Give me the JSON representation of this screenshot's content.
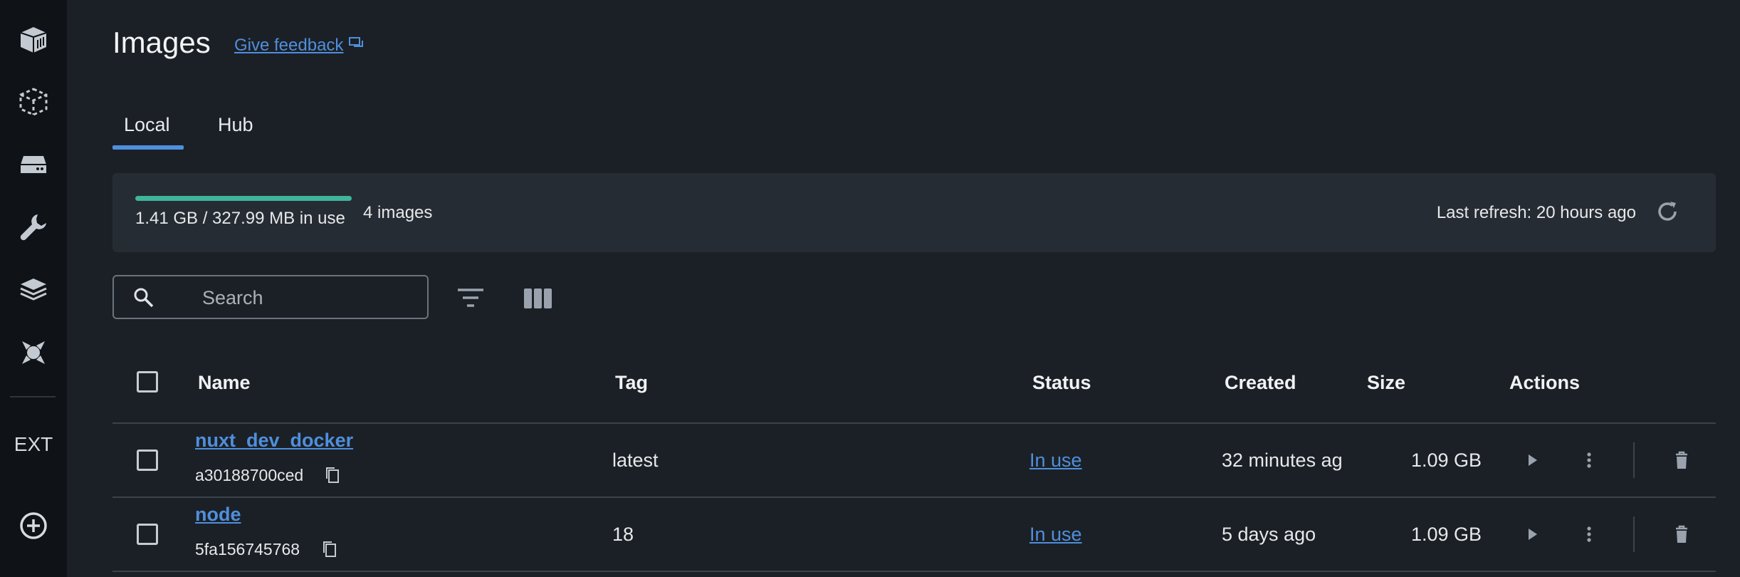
{
  "page": {
    "title": "Images",
    "feedback_label": "Give feedback"
  },
  "sidebar": {
    "icons": [
      "containers-icon",
      "dev-environments-icon",
      "volumes-icon",
      "build-tools-icon",
      "images-layers-icon",
      "extensions-icon"
    ],
    "ext_label": "EXT",
    "add_icon": "add-circle-icon"
  },
  "tabs": [
    {
      "label": "Local",
      "active": true
    },
    {
      "label": "Hub",
      "active": false
    }
  ],
  "usage": {
    "text": "1.41 GB / 327.99 MB in use",
    "count_text": "4 images",
    "bar_fraction": 1.0,
    "bar_color": "#3fb59b",
    "last_refresh": "Last refresh: 20 hours ago"
  },
  "search": {
    "placeholder": "Search",
    "value": ""
  },
  "table": {
    "headers": {
      "name": "Name",
      "tag": "Tag",
      "status": "Status",
      "created": "Created",
      "size": "Size",
      "actions": "Actions"
    },
    "rows": [
      {
        "name": "nuxt_dev_docker",
        "id": "a30188700ced",
        "tag": "latest",
        "status": "In use",
        "created": "32 minutes ag",
        "size": "1.09 GB"
      },
      {
        "name": "node",
        "id": "5fa156745768",
        "tag": "18",
        "status": "In use",
        "created": "5 days ago",
        "size": "1.09 GB"
      }
    ]
  },
  "colors": {
    "accent": "#4f8fdc",
    "usage_fill": "#3fb59b",
    "background": "#1b2026",
    "sidebar": "#0f1216"
  }
}
